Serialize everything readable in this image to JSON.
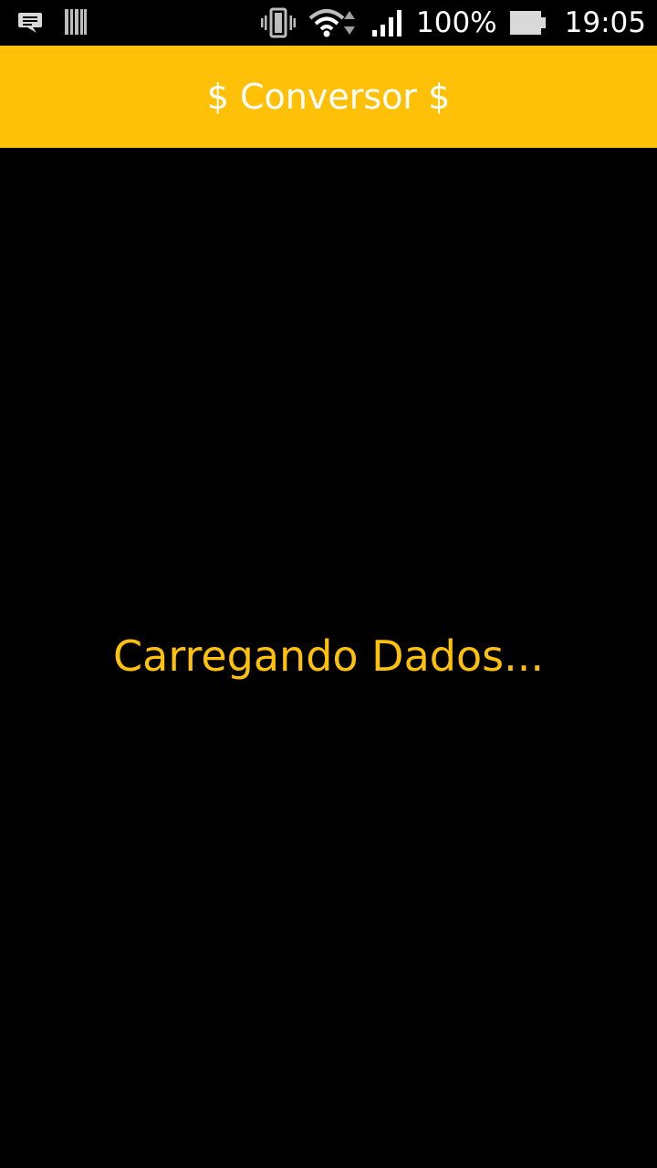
{
  "status_bar": {
    "icons": [
      "chat-notification-icon",
      "barcode-icon",
      "vibrate-icon",
      "wifi-icon",
      "signal-icon",
      "battery-icon"
    ],
    "battery": "100%",
    "time": "19:05"
  },
  "app_bar": {
    "title": "$ Conversor $",
    "color": "#FFC107"
  },
  "main": {
    "loading_text": "Carregando Dados...",
    "text_color": "#FFC107",
    "background": "#000000"
  }
}
